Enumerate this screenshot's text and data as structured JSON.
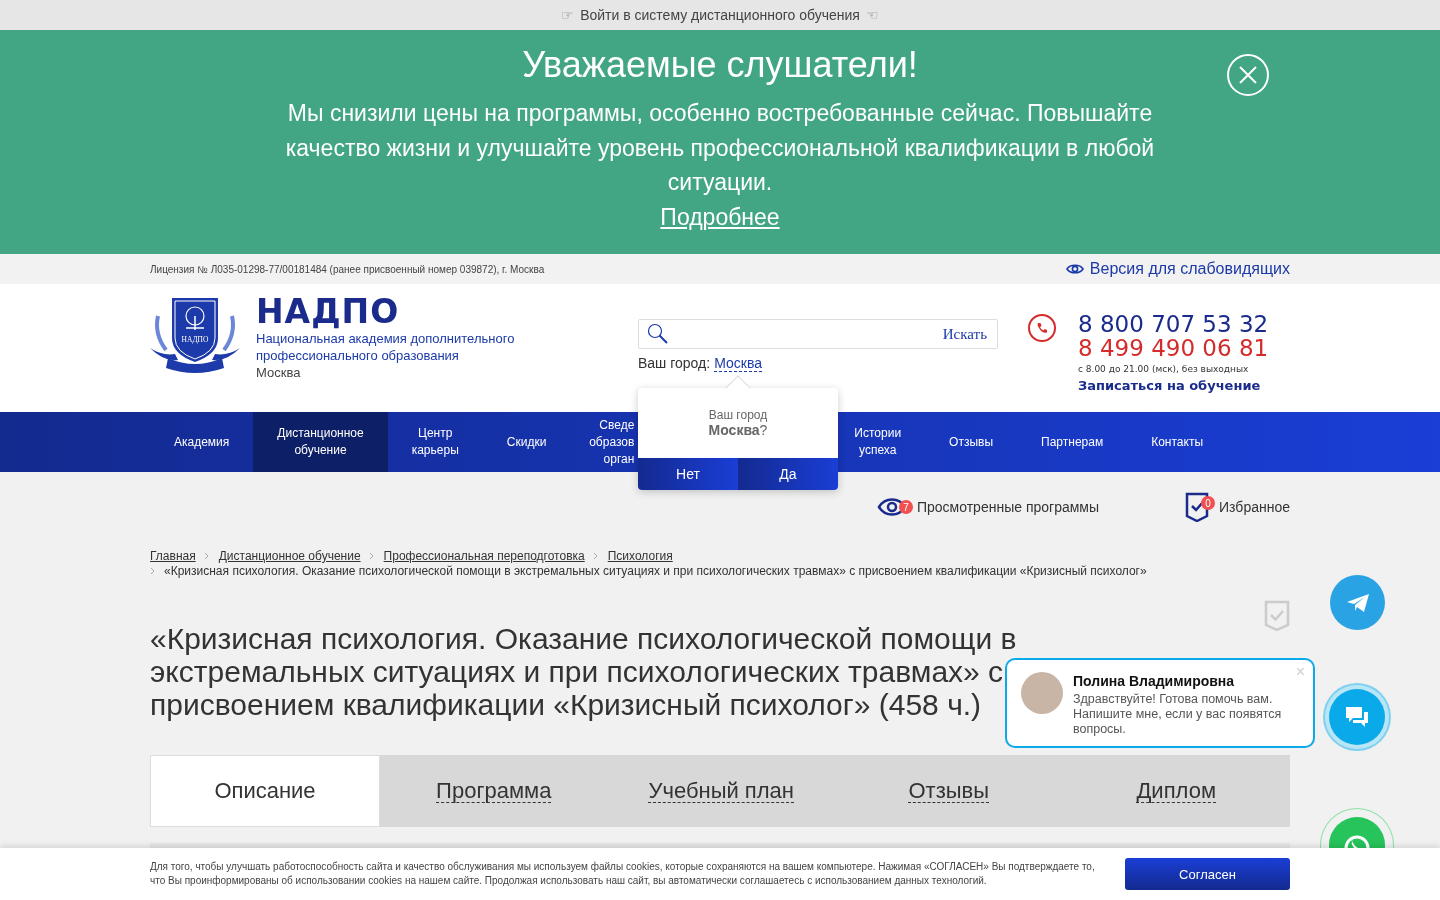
{
  "top_bar": {
    "icon_left": "☞",
    "text": "Войти в систему дистанционного обучения",
    "icon_right": "☜"
  },
  "banner": {
    "title": "Уважаемые слушатели!",
    "text": "Мы снизили цены на программы, особенно востребованные сейчас. Повышайте качество жизни и улучшайте уровень профессиональной квалификации в любой ситуации.",
    "link": "Подробнее"
  },
  "license": "Лицензия № Л035-01298-77/00181484 (ранее присвоенный номер 039872), г. Москва",
  "accessibility_link": "Версия для слабовидящих",
  "logo": {
    "emblem_text": "НАДПО",
    "name": "НАДПО",
    "subtitle": "Национальная академия дополнительного профессионального образования",
    "city": "Москва"
  },
  "search": {
    "button": "Искать"
  },
  "city": {
    "label": "Ваш город:",
    "value": "Москва"
  },
  "phones": [
    {
      "number": "8 800 707 53 32",
      "color": "#1a2b8c"
    },
    {
      "number": "8 499 490 06 81",
      "color": "#d52b2b"
    }
  ],
  "hours": "с 8.00 до 21.00 (мск), без выходных",
  "signup_link": "Записаться на обучение",
  "nav": [
    {
      "lines": [
        "Академия"
      ],
      "selected": false
    },
    {
      "lines": [
        "Дистанционное",
        "обучение"
      ],
      "selected": true
    },
    {
      "lines": [
        "Центр",
        "карьеры"
      ],
      "selected": false
    },
    {
      "lines": [
        "Скидки"
      ],
      "selected": false
    },
    {
      "lines": [
        "Сведе",
        "образов",
        "орган"
      ],
      "selected": false,
      "kind": "covered"
    },
    {
      "lines": [
        "Истории",
        "успеха"
      ],
      "selected": false
    },
    {
      "lines": [
        "Отзывы"
      ],
      "selected": false
    },
    {
      "lines": [
        "Партнерам"
      ],
      "selected": false
    },
    {
      "lines": [
        "Контакты"
      ],
      "selected": false
    }
  ],
  "city_popup": {
    "question": "Ваш город",
    "city": "**Москва**?",
    "buttons": [
      "Нет",
      "Да"
    ]
  },
  "viewed": {
    "label": "Просмотренные программы",
    "count": "7"
  },
  "favorites": {
    "label": "Избранное",
    "count": "0"
  },
  "breadcrumbs": [
    "Главная",
    "Дистанционное обучение",
    "Профессиональная переподготовка",
    "Психология"
  ],
  "breadcrumb_current": "«Кризисная психология. Оказание психологической помощи в экстремальных ситуациях и при психологических травмах» с присвоением квалификации «Кризисный психолог»",
  "title": "«Кризисная психология. Оказание психологической помощи в экстремальных ситуациях и при психологических травмах» с присвоением квалификации «Кризисный психолог» (458 ч.)",
  "tabs": [
    {
      "label": "Описание",
      "selected": true
    },
    {
      "label": "Программа",
      "selected": false
    },
    {
      "label": "Учебный план",
      "selected": false
    },
    {
      "label": "Отзывы",
      "selected": false
    },
    {
      "label": "Диплом",
      "selected": false
    }
  ],
  "chat_popup": {
    "name": "Полина Владимировна",
    "message": "Здравствуйте! Готова помочь вам. Напишите мне, если у вас появятся вопросы.",
    "close": "×"
  },
  "cookie": {
    "text": "Для того, чтобы улучшать работоспособность сайта и качество обслуживания мы используем файлы cookies, которые сохраняются на вашем компьютере. Нажимая «СОГЛАСЕН» Вы подтверждаете то, что Вы проинформированы об использовании cookies на нашем сайте. Продолжая использовать наш сайт, вы автоматически соглашаетесь с использованием данных технологий.",
    "button": "Согласен"
  }
}
